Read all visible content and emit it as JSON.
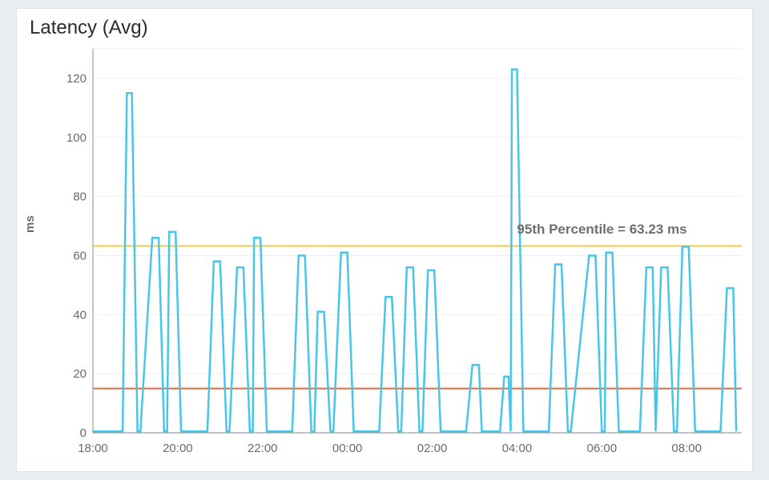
{
  "title": "Latency (Avg)",
  "annotation_text": "95th Percentile = 63.23 ms",
  "chart_data": {
    "type": "line",
    "title": "Latency (Avg)",
    "xlabel": "",
    "ylabel": "ms",
    "x_ticks": [
      "18:00",
      "20:00",
      "22:00",
      "00:00",
      "02:00",
      "04:00",
      "06:00",
      "08:00"
    ],
    "y_ticks": [
      0,
      20,
      40,
      60,
      80,
      100,
      120
    ],
    "xlim": [
      18.0,
      33.3
    ],
    "ylim": [
      0,
      130
    ],
    "reference_lines": [
      {
        "label": "95th Percentile",
        "value": 63.23,
        "color": "#f2c94b"
      },
      {
        "label": "",
        "value": 15,
        "color": "#e06a3f"
      }
    ],
    "annotations": [
      {
        "text": "95th Percentile = 63.23 ms",
        "x": 28.0,
        "y": 66
      }
    ],
    "series": [
      {
        "name": "Latency (Avg)",
        "color": "#48c6e9",
        "x": [
          18.0,
          18.7,
          18.8,
          18.92,
          19.05,
          19.12,
          19.4,
          19.55,
          19.68,
          19.75,
          19.8,
          19.95,
          20.08,
          20.15,
          20.7,
          20.85,
          21.0,
          21.15,
          21.22,
          21.4,
          21.55,
          21.7,
          21.77,
          21.8,
          21.95,
          22.1,
          22.17,
          22.7,
          22.85,
          23.0,
          23.15,
          23.22,
          23.3,
          23.45,
          23.6,
          23.67,
          23.85,
          24.0,
          24.15,
          24.22,
          24.75,
          24.9,
          25.05,
          25.2,
          25.27,
          25.4,
          25.55,
          25.7,
          25.77,
          25.9,
          26.05,
          26.2,
          26.27,
          26.8,
          26.95,
          27.1,
          27.17,
          27.6,
          27.7,
          27.8,
          27.85,
          27.88,
          28.0,
          28.15,
          28.22,
          28.75,
          28.9,
          29.05,
          29.2,
          29.27,
          29.7,
          29.85,
          30.0,
          30.07,
          30.1,
          30.25,
          30.4,
          30.47,
          30.9,
          31.05,
          31.2,
          31.27,
          31.4,
          31.55,
          31.7,
          31.77,
          31.9,
          32.05,
          32.2,
          32.27,
          32.8,
          32.95,
          33.1,
          33.17
        ],
        "y": [
          0.5,
          0.5,
          115,
          115,
          0.5,
          0.5,
          66,
          66,
          0.5,
          0.5,
          68,
          68,
          0.5,
          0.5,
          0.5,
          58,
          58,
          0.5,
          0.5,
          56,
          56,
          0.5,
          0.5,
          66,
          66,
          0.5,
          0.5,
          0.5,
          60,
          60,
          0.5,
          0.5,
          41,
          41,
          0.5,
          0.5,
          61,
          61,
          0.5,
          0.5,
          0.5,
          46,
          46,
          0.5,
          0.5,
          56,
          56,
          0.5,
          0.5,
          55,
          55,
          0.5,
          0.5,
          0.5,
          23,
          23,
          0.5,
          0.5,
          19,
          19,
          0.5,
          123,
          123,
          0.5,
          0.5,
          0.5,
          57,
          57,
          0.5,
          0.5,
          60,
          60,
          0.5,
          0.5,
          61,
          61,
          0.5,
          0.5,
          0.5,
          56,
          56,
          0.5,
          56,
          56,
          0.5,
          0.5,
          63,
          63,
          0.5,
          0.5,
          0.5,
          49,
          49,
          0.5
        ]
      }
    ]
  }
}
